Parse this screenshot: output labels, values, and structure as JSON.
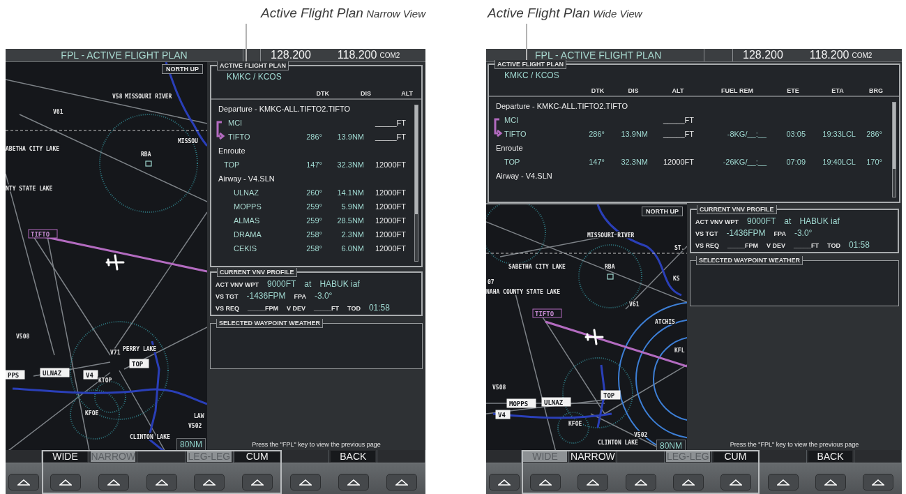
{
  "screens": [
    {
      "kind": "narrow",
      "caption": {
        "title": "Active Flight Plan",
        "view": "Narrow View"
      },
      "header": {
        "title": "FPL - ACTIVE FLIGHT PLAN",
        "active_frequency": "128.200",
        "standby_frequency": "118.200",
        "radio": "COM2"
      },
      "map": {
        "orientation": "NORTH UP",
        "range": "80NM",
        "labels": [
          {
            "kind": "plain",
            "text": "V58"
          },
          {
            "kind": "plain",
            "text": "MISSOURI RIVER"
          },
          {
            "kind": "plain",
            "text": "V61"
          },
          {
            "kind": "plain",
            "text": "ABETHA CITY LAKE"
          },
          {
            "kind": "plain",
            "text": "MISSOU"
          },
          {
            "kind": "plain",
            "text": "RBA"
          },
          {
            "kind": "plain",
            "text": "NTY STATE LAKE"
          },
          {
            "kind": "flag",
            "text": "TIFTO"
          },
          {
            "kind": "plain",
            "text": "V508"
          },
          {
            "kind": "plain",
            "text": "V71"
          },
          {
            "kind": "plain",
            "text": "PERRY LAKE"
          },
          {
            "kind": "box",
            "text": "TOP"
          },
          {
            "kind": "box",
            "text": "ULNAZ"
          },
          {
            "kind": "box",
            "text": "PPS"
          },
          {
            "kind": "box",
            "text": "V4"
          },
          {
            "kind": "plain",
            "text": "KTOP"
          },
          {
            "kind": "plain",
            "text": "KFOE"
          },
          {
            "kind": "plain",
            "text": "V502"
          },
          {
            "kind": "plain",
            "text": "LAW"
          },
          {
            "kind": "plain",
            "text": "CLINTON LAKE"
          }
        ]
      },
      "flight_plan": {
        "title": "ACTIVE FLIGHT PLAN",
        "route": "KMKC / KCOS",
        "columns": {
          "dtk": "DTK",
          "dis": "DIS",
          "alt": "ALT"
        },
        "rows": [
          {
            "kind": "departure",
            "text": "Departure - KMKC-ALL.TIFTO2.TIFTO",
            "children": [
              {
                "name": "MCI",
                "active": false,
                "alt": "_____FT"
              },
              {
                "name": "TIFTO",
                "active": true,
                "dtk": "286°",
                "dis": "13.9NM",
                "alt": "_____FT"
              }
            ]
          },
          {
            "kind": "enroute",
            "text": "Enroute",
            "children": [
              {
                "name": "TOP",
                "active": false,
                "dtk": "147°",
                "dis": "32.3NM",
                "alt": "12000FT"
              }
            ]
          },
          {
            "kind": "airway",
            "text": "Airway - V4.SLN",
            "children": [
              {
                "name": "ULNAZ",
                "active": false,
                "dtk": "260°",
                "dis": "14.1NM",
                "alt": "12000FT"
              },
              {
                "name": "MOPPS",
                "active": false,
                "dtk": "259°",
                "dis": "5.9NM",
                "alt": "12000FT"
              },
              {
                "name": "ALMAS",
                "active": false,
                "dtk": "259°",
                "dis": "28.5NM",
                "alt": "12000FT"
              },
              {
                "name": "DRAMA",
                "active": false,
                "dtk": "258°",
                "dis": "2.3NM",
                "alt": "12000FT"
              },
              {
                "name": "CEKIS",
                "active": false,
                "dtk": "258°",
                "dis": "6.0NM",
                "alt": "12000FT"
              }
            ]
          }
        ]
      },
      "vnv_profile": {
        "title": "CURRENT VNV PROFILE",
        "lines": [
          [
            {
              "kind": "label",
              "text": "ACT VNV WPT"
            },
            {
              "kind": "value",
              "text": "9000FT"
            },
            {
              "kind": "value",
              "text": "at"
            },
            {
              "kind": "value",
              "text": "HABUK iaf"
            }
          ],
          [
            {
              "kind": "label",
              "text": "VS TGT"
            },
            {
              "kind": "value",
              "text": "-1436FPM"
            },
            {
              "kind": "label",
              "text": "FPA"
            },
            {
              "kind": "value",
              "text": "-3.0°"
            }
          ],
          [
            {
              "kind": "label",
              "text": "VS REQ"
            },
            {
              "kind": "label",
              "text": "_____FPM"
            },
            {
              "kind": "label",
              "text": "V DEV"
            },
            {
              "kind": "label",
              "text": "_____FT"
            },
            {
              "kind": "label",
              "text": "TOD"
            },
            {
              "kind": "value",
              "text": "01:58"
            }
          ]
        ]
      },
      "weather": {
        "title": "SELECTED WAYPOINT WEATHER"
      },
      "message": "Press the \"FPL\" key to view the previous page",
      "softkeys": [
        {
          "kind": "blank"
        },
        {
          "kind": "key",
          "label": "WIDE",
          "selected": false
        },
        {
          "kind": "key",
          "label": "NARROW",
          "selected": true
        },
        {
          "kind": "blank"
        },
        {
          "kind": "key",
          "label": "LEG-LEG",
          "selected": true
        },
        {
          "kind": "key",
          "label": "CUM",
          "selected": false
        },
        {
          "kind": "blank"
        },
        {
          "kind": "key",
          "label": "BACK",
          "selected": false
        },
        {
          "kind": "blank"
        }
      ]
    },
    {
      "kind": "wide",
      "caption": {
        "title": "Active Flight Plan",
        "view": "Wide View"
      },
      "header": {
        "title": "FPL - ACTIVE FLIGHT PLAN",
        "active_frequency": "128.200",
        "standby_frequency": "118.200",
        "radio": "COM2"
      },
      "map": {
        "orientation": "NORTH UP",
        "range": "80NM",
        "labels": [
          {
            "kind": "plain",
            "text": "MISSOURI RIVER"
          },
          {
            "kind": "plain",
            "text": "ST."
          },
          {
            "kind": "plain",
            "text": "SABETHA CITY LAKE"
          },
          {
            "kind": "plain",
            "text": "07"
          },
          {
            "kind": "plain",
            "text": "NAHA COUNTY STATE LAKE"
          },
          {
            "kind": "plain",
            "text": "RBA"
          },
          {
            "kind": "plain",
            "text": "KS"
          },
          {
            "kind": "plain",
            "text": "V61"
          },
          {
            "kind": "flag",
            "text": "TIFTO"
          },
          {
            "kind": "plain",
            "text": "ATCHIS"
          },
          {
            "kind": "plain",
            "text": "KFL"
          },
          {
            "kind": "plain",
            "text": "V508"
          },
          {
            "kind": "box",
            "text": "TOP"
          },
          {
            "kind": "box",
            "text": "MOPPS"
          },
          {
            "kind": "box",
            "text": "ULNAZ"
          },
          {
            "kind": "box",
            "text": "V4"
          },
          {
            "kind": "plain",
            "text": "KFOE"
          },
          {
            "kind": "plain",
            "text": "V502"
          },
          {
            "kind": "plain",
            "text": "CLINTON LAKE"
          }
        ]
      },
      "flight_plan": {
        "title": "ACTIVE FLIGHT PLAN",
        "route": "KMKC / KCOS",
        "columns": {
          "dtk": "DTK",
          "dis": "DIS",
          "alt": "ALT",
          "fuel_rem": "FUEL REM",
          "ete": "ETE",
          "eta": "ETA",
          "brg": "BRG"
        },
        "rows": [
          {
            "kind": "departure",
            "text": "Departure - KMKC-ALL.TIFTO2.TIFTO",
            "children": [
              {
                "name": "MCI",
                "active": false,
                "alt": "_____FT"
              },
              {
                "name": "TIFTO",
                "active": true,
                "dtk": "286°",
                "dis": "13.9NM",
                "alt": "_____FT",
                "fuel_rem": "-8KG/__:__",
                "ete": "03:05",
                "eta": "19:33LCL",
                "brg": "286°"
              }
            ]
          },
          {
            "kind": "enroute",
            "text": "Enroute",
            "children": [
              {
                "name": "TOP",
                "active": false,
                "dtk": "147°",
                "dis": "32.3NM",
                "alt": "12000FT",
                "fuel_rem": "-26KG/__:__",
                "ete": "07:09",
                "eta": "19:40LCL",
                "brg": "170°"
              }
            ]
          },
          {
            "kind": "airway",
            "text": "Airway - V4.SLN"
          }
        ]
      },
      "vnv_profile": {
        "title": "CURRENT VNV PROFILE",
        "lines": [
          [
            {
              "kind": "label",
              "text": "ACT VNV WPT"
            },
            {
              "kind": "value",
              "text": "9000FT"
            },
            {
              "kind": "value",
              "text": "at"
            },
            {
              "kind": "value",
              "text": "HABUK iaf"
            }
          ],
          [
            {
              "kind": "label",
              "text": "VS TGT"
            },
            {
              "kind": "value",
              "text": "-1436FPM"
            },
            {
              "kind": "label",
              "text": "FPA"
            },
            {
              "kind": "value",
              "text": "-3.0°"
            }
          ],
          [
            {
              "kind": "label",
              "text": "VS REQ"
            },
            {
              "kind": "label",
              "text": "_____FPM"
            },
            {
              "kind": "label",
              "text": "V DEV"
            },
            {
              "kind": "label",
              "text": "_____FT"
            },
            {
              "kind": "label",
              "text": "TOD"
            },
            {
              "kind": "value",
              "text": "01:58"
            }
          ]
        ]
      },
      "weather": {
        "title": "SELECTED WAYPOINT WEATHER"
      },
      "message": "Press the \"FPL\" key to view the previous page",
      "softkeys": [
        {
          "kind": "blank"
        },
        {
          "kind": "key",
          "label": "WIDE",
          "selected": true
        },
        {
          "kind": "key",
          "label": "NARROW",
          "selected": false
        },
        {
          "kind": "blank"
        },
        {
          "kind": "key",
          "label": "LEG-LEG",
          "selected": true
        },
        {
          "kind": "key",
          "label": "CUM",
          "selected": false
        },
        {
          "kind": "blank"
        },
        {
          "kind": "key",
          "label": "BACK",
          "selected": false
        },
        {
          "kind": "blank"
        }
      ]
    }
  ]
}
